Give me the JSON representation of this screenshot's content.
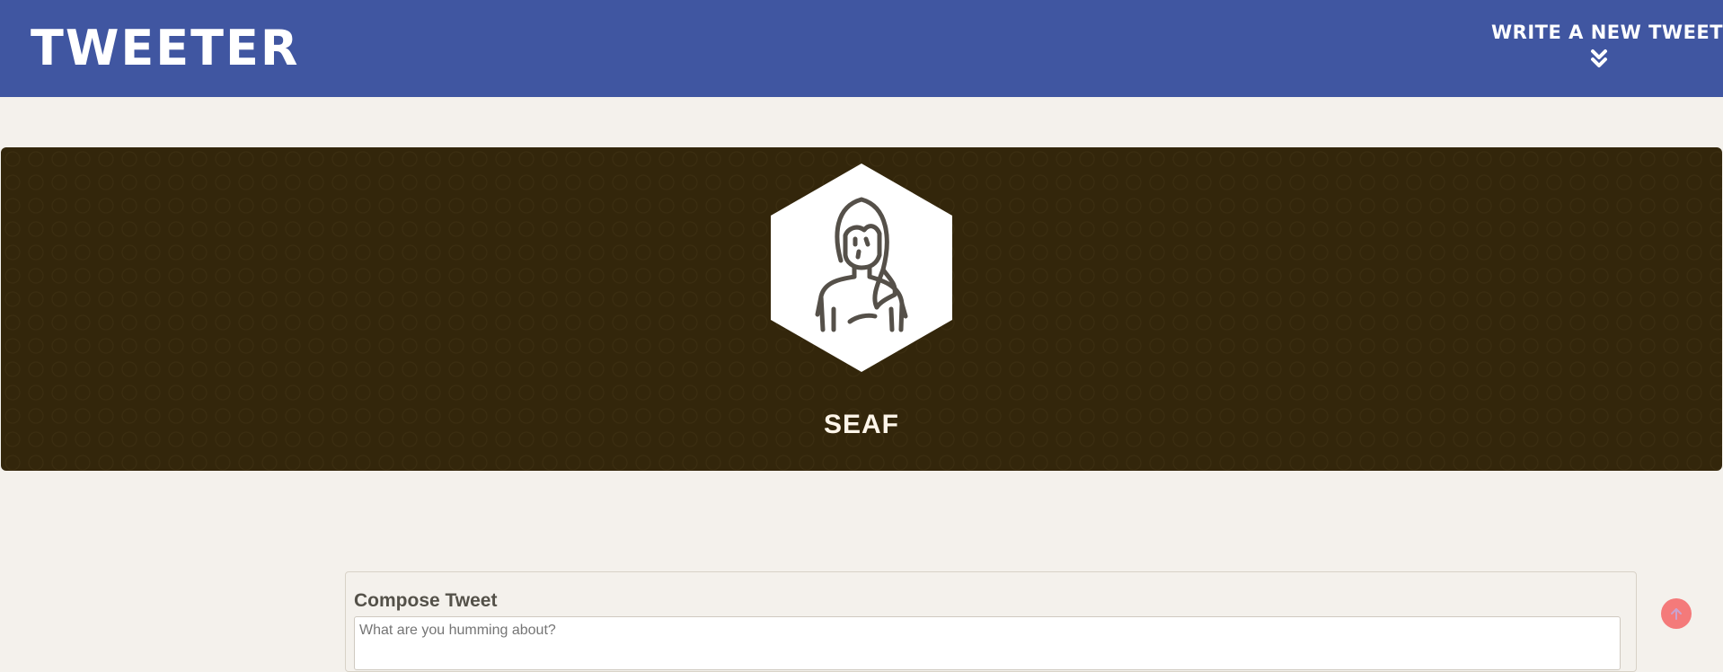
{
  "navbar": {
    "brand": "TWEETER",
    "write_label": "WRITE A NEW TWEET",
    "write_icon": "double-chevron-down-icon",
    "background_color": "#4056a1"
  },
  "profile": {
    "avatar_icon": "user-avatar-icon",
    "username": "SEAF",
    "background_color": "#33260b"
  },
  "compose": {
    "title": "Compose Tweet",
    "placeholder": "What are you humming about?",
    "value": ""
  },
  "scroll_top": {
    "icon": "arrow-up-icon",
    "color": "#f47a7a"
  }
}
